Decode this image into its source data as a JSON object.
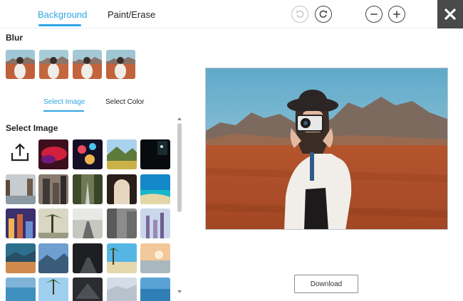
{
  "tabs": {
    "background": "Background",
    "paint_erase": "Paint/Erase"
  },
  "toolbar": {
    "undo_icon": "undo-icon",
    "redo_icon": "redo-icon",
    "zoom_out_icon": "zoom-out-icon",
    "zoom_in_icon": "zoom-in-icon",
    "close_icon": "close-icon"
  },
  "blur": {
    "title": "Blur",
    "thumbnails": [
      "blur-1",
      "blur-2",
      "blur-3",
      "blur-4"
    ]
  },
  "subtabs": {
    "select_image": "Select Image",
    "select_color": "Select Color"
  },
  "select_image": {
    "title": "Select Image",
    "upload_icon": "upload-icon"
  },
  "download": {
    "label": "Download"
  },
  "colors": {
    "accent": "#2ea6e4",
    "close_bg": "#4a4a4a"
  }
}
